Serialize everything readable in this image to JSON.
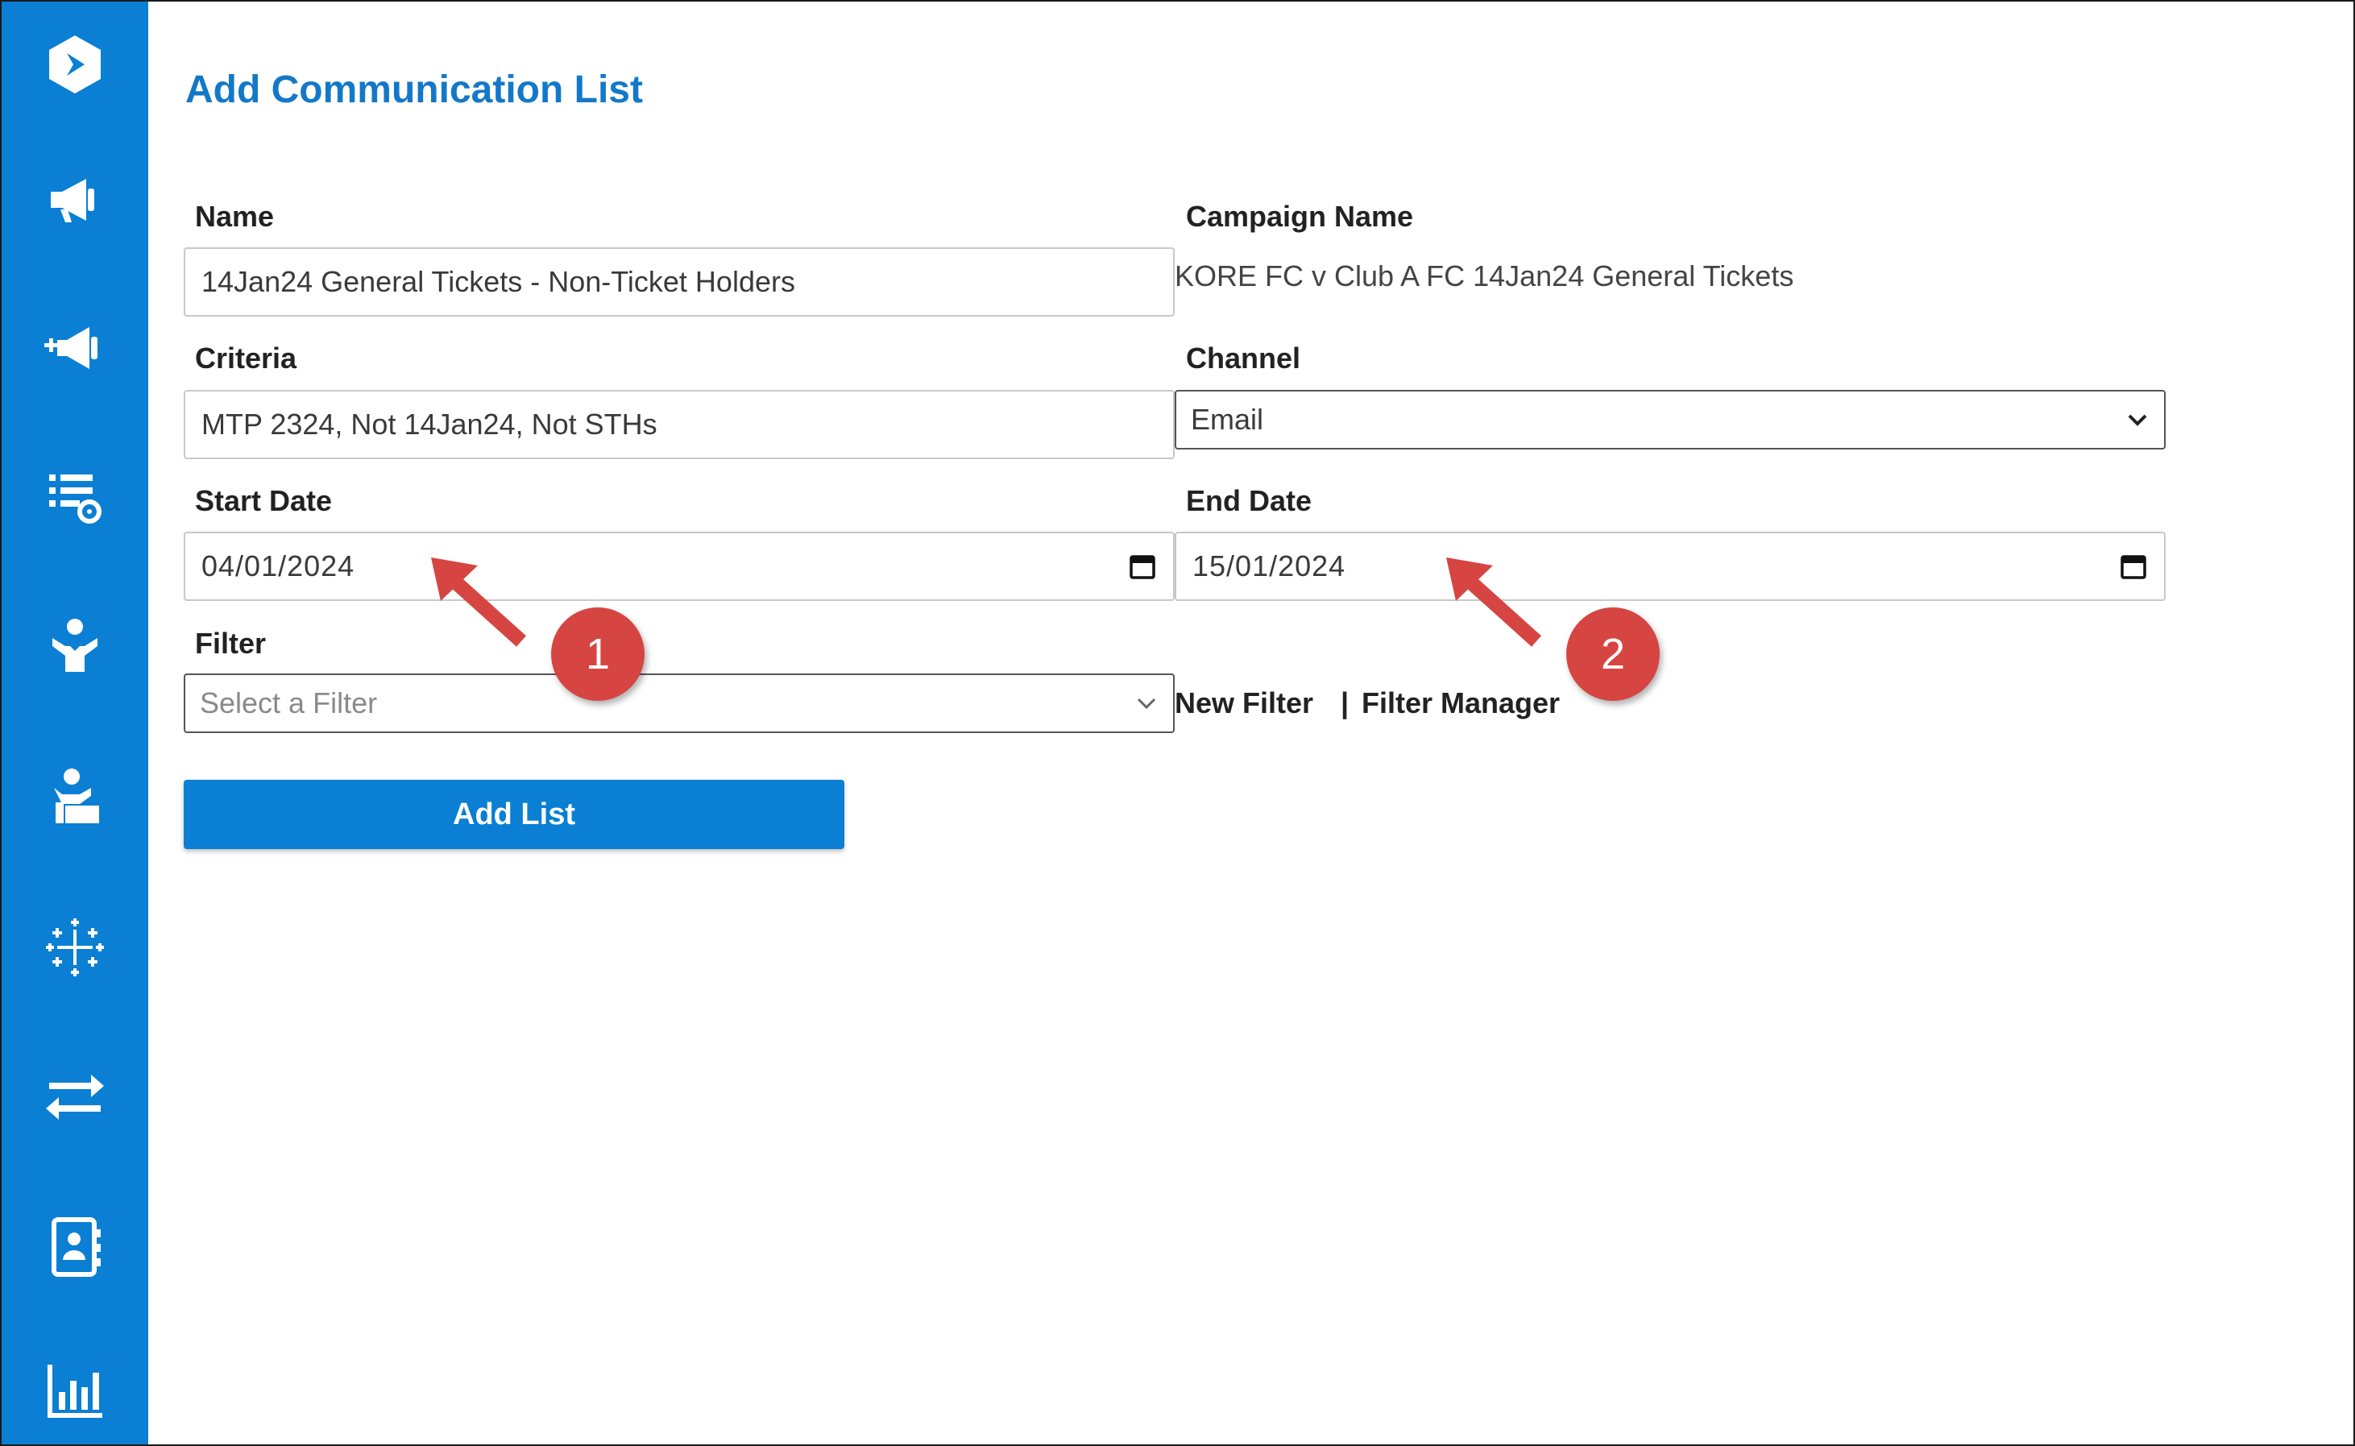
{
  "colors": {
    "sidebar": "#0a7fd3",
    "title": "#1478c8",
    "button": "#0a7fd3",
    "annotation": "#d64541"
  },
  "sidebar": {
    "items": [
      {
        "icon": "app-logo-icon"
      },
      {
        "icon": "megaphone-icon"
      },
      {
        "icon": "megaphone-add-icon"
      },
      {
        "icon": "list-settings-icon"
      },
      {
        "icon": "person-heart-icon"
      },
      {
        "icon": "person-desk-icon"
      },
      {
        "icon": "tableau-icon"
      },
      {
        "icon": "transfer-arrows-icon"
      },
      {
        "icon": "contact-book-icon"
      },
      {
        "icon": "bar-chart-icon"
      }
    ]
  },
  "page": {
    "title": "Add Communication List"
  },
  "form": {
    "name": {
      "label": "Name",
      "value": "14Jan24 General Tickets - Non-Ticket Holders"
    },
    "campaign_name": {
      "label": "Campaign Name",
      "value": "KORE FC v Club A FC 14Jan24 General Tickets"
    },
    "criteria": {
      "label": "Criteria",
      "value": "MTP 2324, Not 14Jan24, Not STHs"
    },
    "channel": {
      "label": "Channel",
      "value": "Email"
    },
    "start_date": {
      "label": "Start Date",
      "value": "04/01/2024"
    },
    "end_date": {
      "label": "End Date",
      "value": "15/01/2024"
    },
    "filter": {
      "label": "Filter",
      "placeholder": "Select a Filter"
    },
    "links": {
      "new_filter": "New Filter",
      "separator": "|",
      "filter_manager": "Filter Manager"
    },
    "submit_label": "Add List"
  },
  "annotations": [
    {
      "number": "1"
    },
    {
      "number": "2"
    }
  ]
}
